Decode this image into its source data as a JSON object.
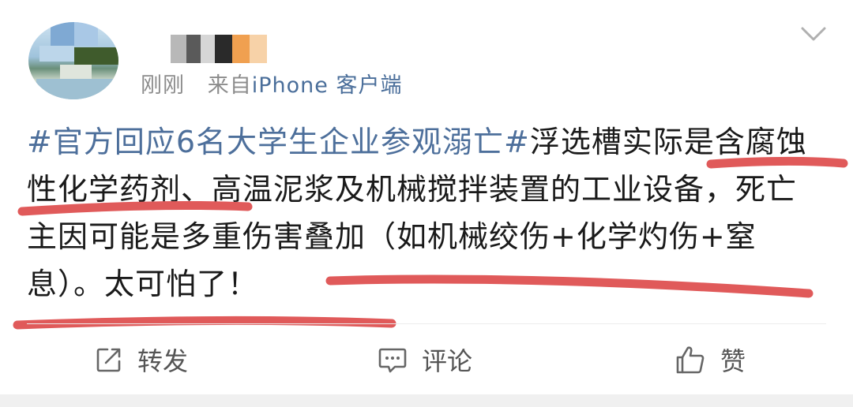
{
  "post": {
    "time": "刚刚",
    "source_prefix": "来自",
    "source": "iPhone 客户端",
    "content": {
      "hashtag": "#官方回应6名大学生企业参观溺亡#",
      "text": "浮选槽实际是含腐蚀性化学药剂、高温泥浆及机械搅拌装置的工业设备，死亡主因可能是多重伤害叠加（如机械绞伤+化学灼伤+窒息）。太可怕了！"
    },
    "annotation_color": "#e05a5a"
  },
  "actions": {
    "repost_label": "转发",
    "comment_label": "评论",
    "like_label": "赞"
  },
  "icons": {
    "more": "chevron-down-icon",
    "repost": "repost-icon",
    "comment": "comment-icon",
    "like": "thumbs-up-icon"
  }
}
